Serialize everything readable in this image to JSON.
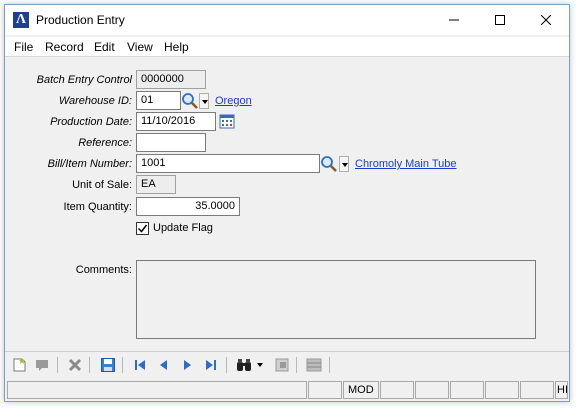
{
  "window": {
    "title": "Production Entry"
  },
  "menu": [
    "File",
    "Record",
    "Edit",
    "View",
    "Help"
  ],
  "form": {
    "batch_entry_control": {
      "label": "Batch Entry Control",
      "value": "0000000"
    },
    "warehouse_id": {
      "label": "Warehouse ID:",
      "value": "01",
      "description": "Oregon"
    },
    "production_date": {
      "label": "Production Date:",
      "value": "11/10/2016"
    },
    "reference": {
      "label": "Reference:",
      "value": ""
    },
    "bill_item_number": {
      "label": "Bill/Item Number:",
      "value": "1001",
      "description": "Chromoly Main Tube"
    },
    "unit_of_sale": {
      "label": "Unit of Sale:",
      "value": "EA"
    },
    "item_quantity": {
      "label": "Item Quantity:",
      "value": "35.0000"
    },
    "update_flag": {
      "label": "Update Flag",
      "checked": true
    },
    "comments": {
      "label": "Comments:",
      "value": ""
    }
  },
  "toolbar": {
    "icons": [
      "new-record-icon",
      "post-icon",
      "delete-icon",
      "save-icon",
      "first-record-icon",
      "previous-record-icon",
      "next-record-icon",
      "last-record-icon",
      "find-icon",
      "find-dropdown-icon",
      "document-icon",
      "grid-icon"
    ]
  },
  "status": {
    "mode": "MOD",
    "last": "HI"
  },
  "colors": {
    "link": "#1a3ccf",
    "title_bg": "#ffffff",
    "window_bg": "#f0f0f0",
    "accent": "#1f3f8f"
  }
}
